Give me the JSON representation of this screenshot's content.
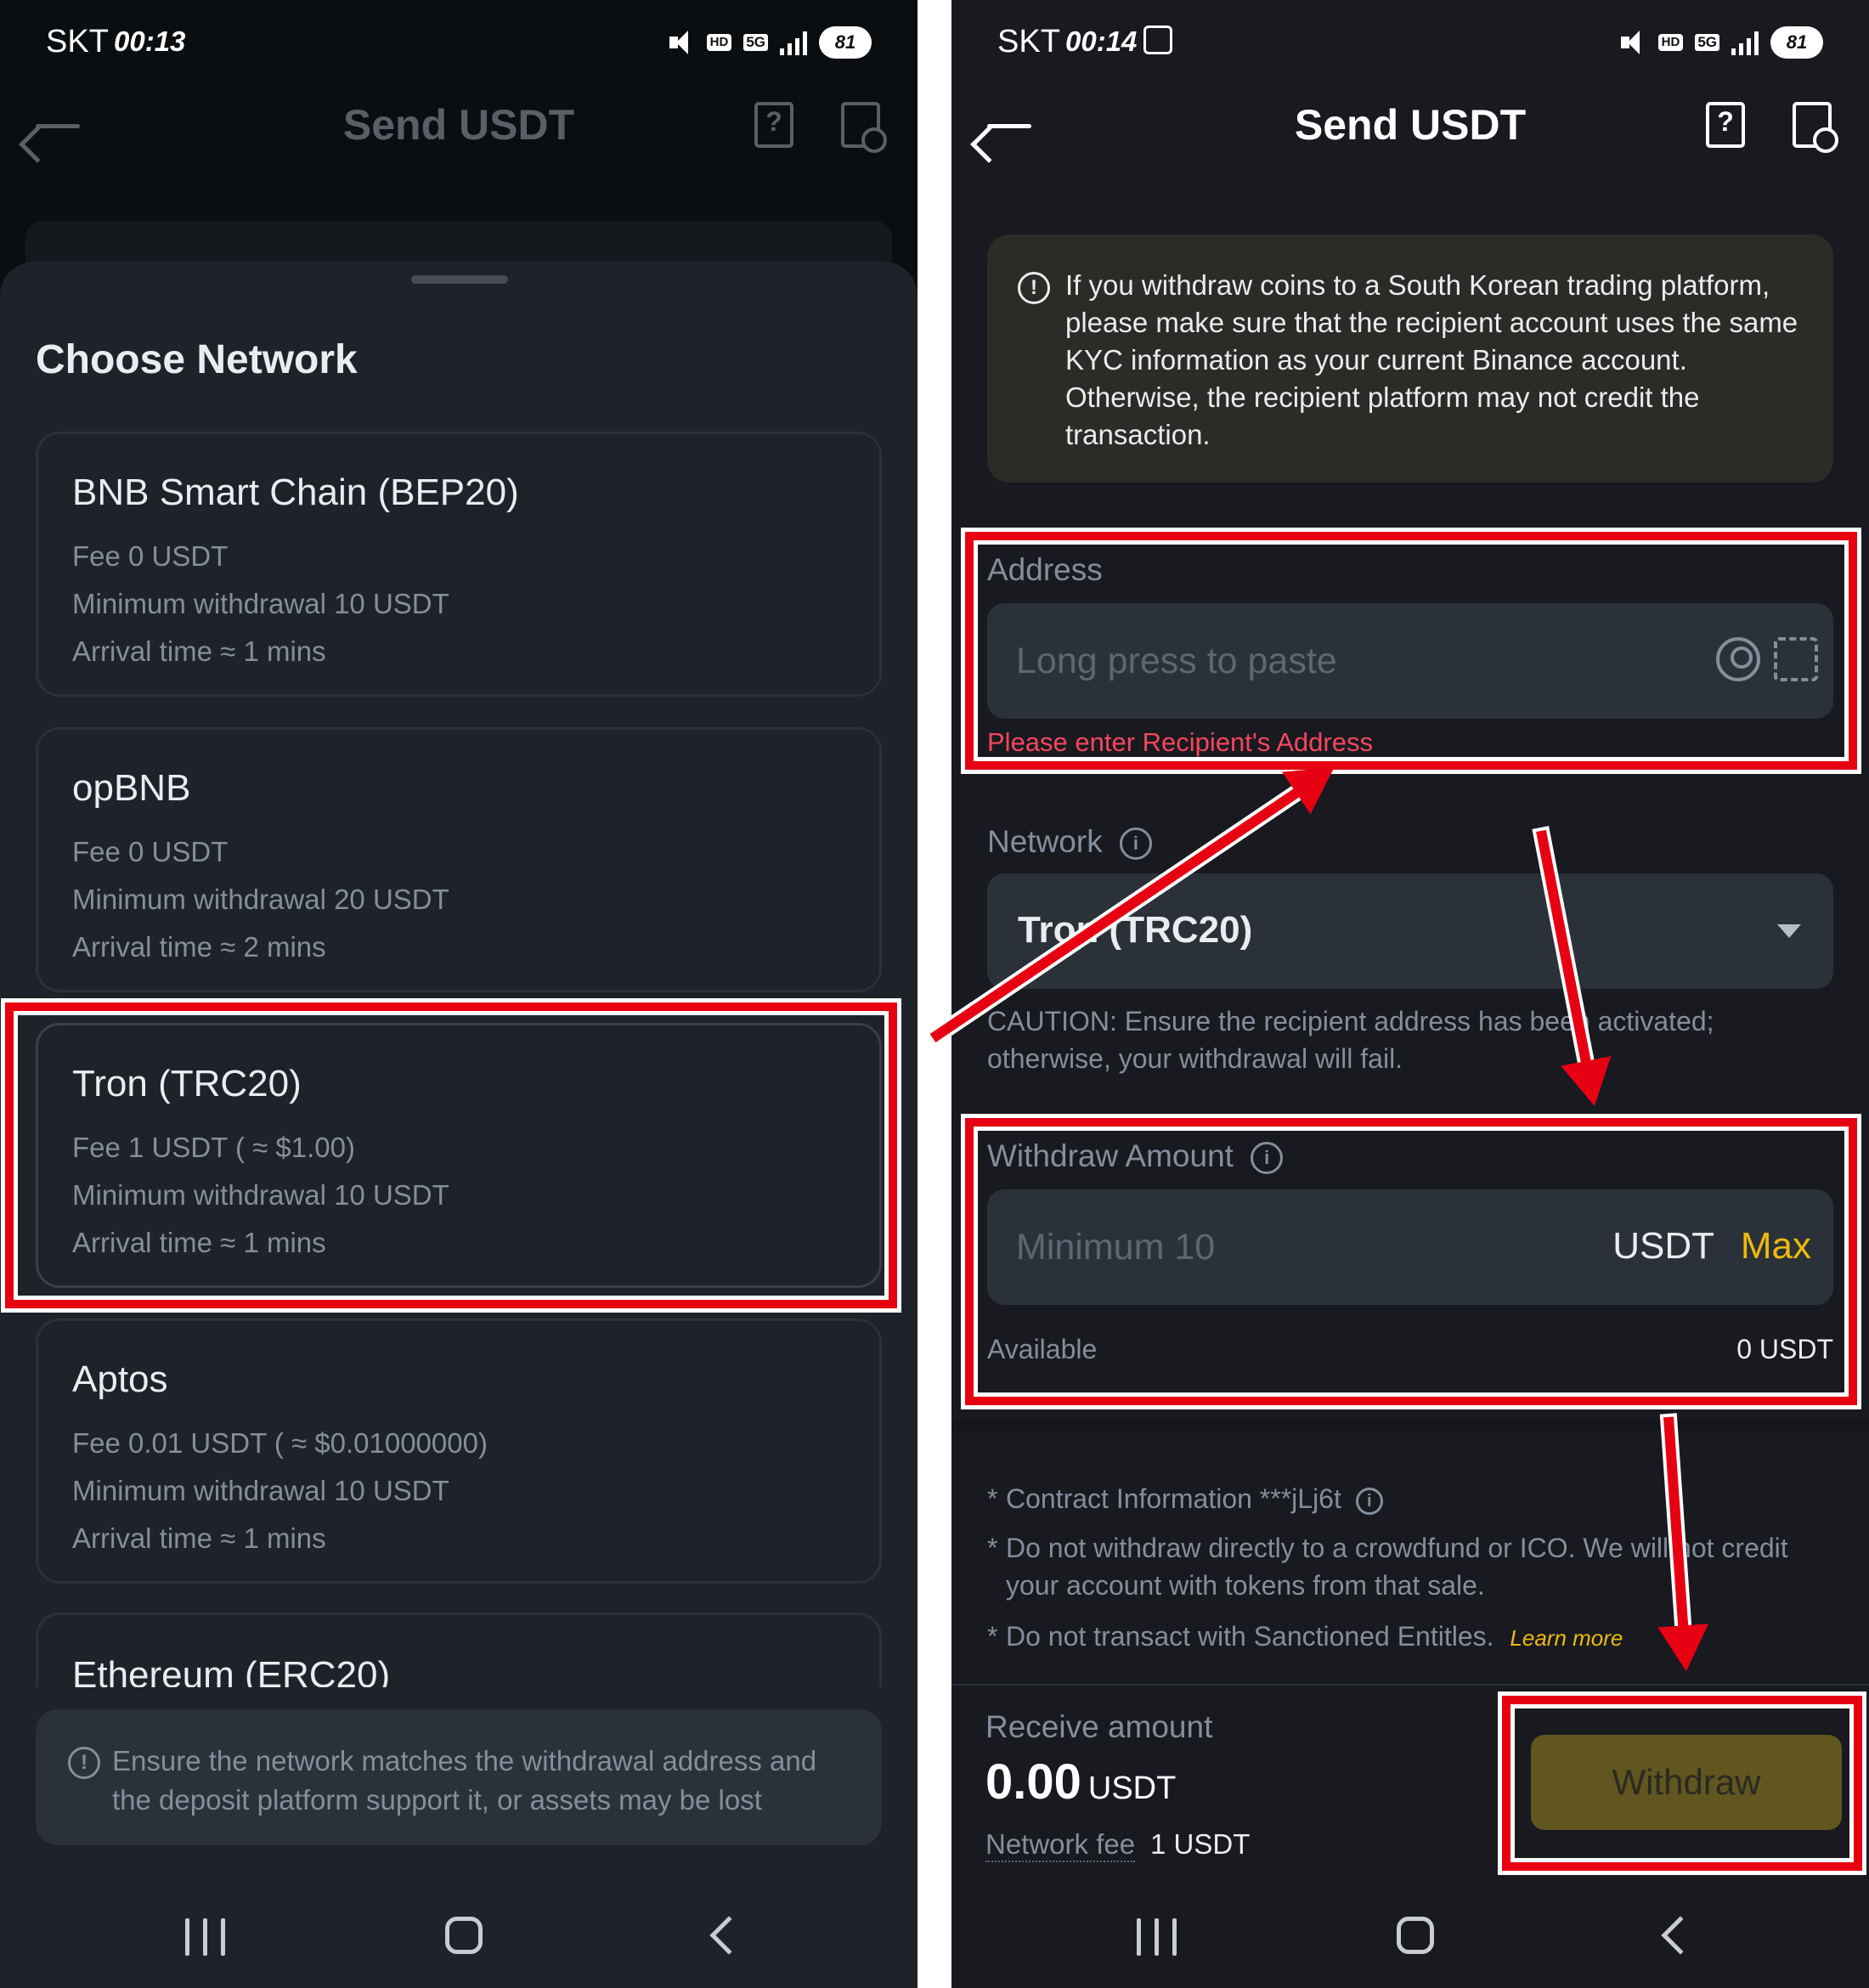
{
  "left": {
    "status": {
      "carrier": "SKT",
      "time": "00:13",
      "battery": "81",
      "hd": "HD",
      "net": "5G"
    },
    "header": {
      "title": "Send USDT"
    },
    "sheet": {
      "title": "Choose Network",
      "networks": [
        {
          "name": "BNB Smart Chain (BEP20)",
          "fee": "Fee 0 USDT",
          "min": "Minimum withdrawal 10 USDT",
          "arrival": "Arrival time ≈ 1 mins"
        },
        {
          "name": "opBNB",
          "fee": "Fee 0 USDT",
          "min": "Minimum withdrawal 20 USDT",
          "arrival": "Arrival time ≈ 2 mins"
        },
        {
          "name": "Tron (TRC20)",
          "fee": "Fee 1 USDT ( ≈ $1.00)",
          "min": "Minimum withdrawal 10 USDT",
          "arrival": "Arrival time ≈ 1 mins"
        },
        {
          "name": "Aptos",
          "fee": "Fee 0.01 USDT ( ≈ $0.01000000)",
          "min": "Minimum withdrawal 10 USDT",
          "arrival": "Arrival time ≈ 1 mins"
        },
        {
          "name": "Ethereum (ERC20)"
        }
      ],
      "notice": "Ensure the network matches the withdrawal address and the deposit platform support it,   or assets may be lost"
    }
  },
  "right": {
    "status": {
      "carrier": "SKT",
      "time": "00:14",
      "battery": "81",
      "hd": "HD",
      "net": "5G"
    },
    "header": {
      "title": "Send USDT"
    },
    "warning": "If you withdraw coins to a South Korean trading platform, please make sure that the recipient account uses the same KYC information as your current Binance account. Otherwise, the recipient platform may not credit the transaction.",
    "address": {
      "label": "Address",
      "placeholder": "Long press to paste",
      "error": "Please enter Recipient's Address"
    },
    "network": {
      "label": "Network",
      "value": "Tron (TRC20)",
      "caution": "CAUTION: Ensure the recipient address has been activated; otherwise, your withdrawal will fail."
    },
    "amount": {
      "label": "Withdraw Amount",
      "placeholder": "Minimum 10",
      "unit": "USDT",
      "max": "Max",
      "available_label": "Available",
      "available_value": "0 USDT"
    },
    "notes": {
      "contract": "Contract Information ***jLj6t",
      "crowdfund": "Do not withdraw directly to a crowdfund or ICO. We will not credit your account with tokens from that sale.",
      "sanction": "Do not transact with Sanctioned Entitles.",
      "learn_more": "Learn more",
      "star": "*"
    },
    "bottom": {
      "receive_label": "Receive amount",
      "receive_value": "0.00",
      "receive_unit": "USDT",
      "fee_label": "Network fee",
      "fee_value": "1 USDT",
      "withdraw": "Withdraw"
    }
  },
  "colors": {
    "accent": "#f0b90b",
    "error": "#f6465d",
    "highlight": "#e60012"
  }
}
